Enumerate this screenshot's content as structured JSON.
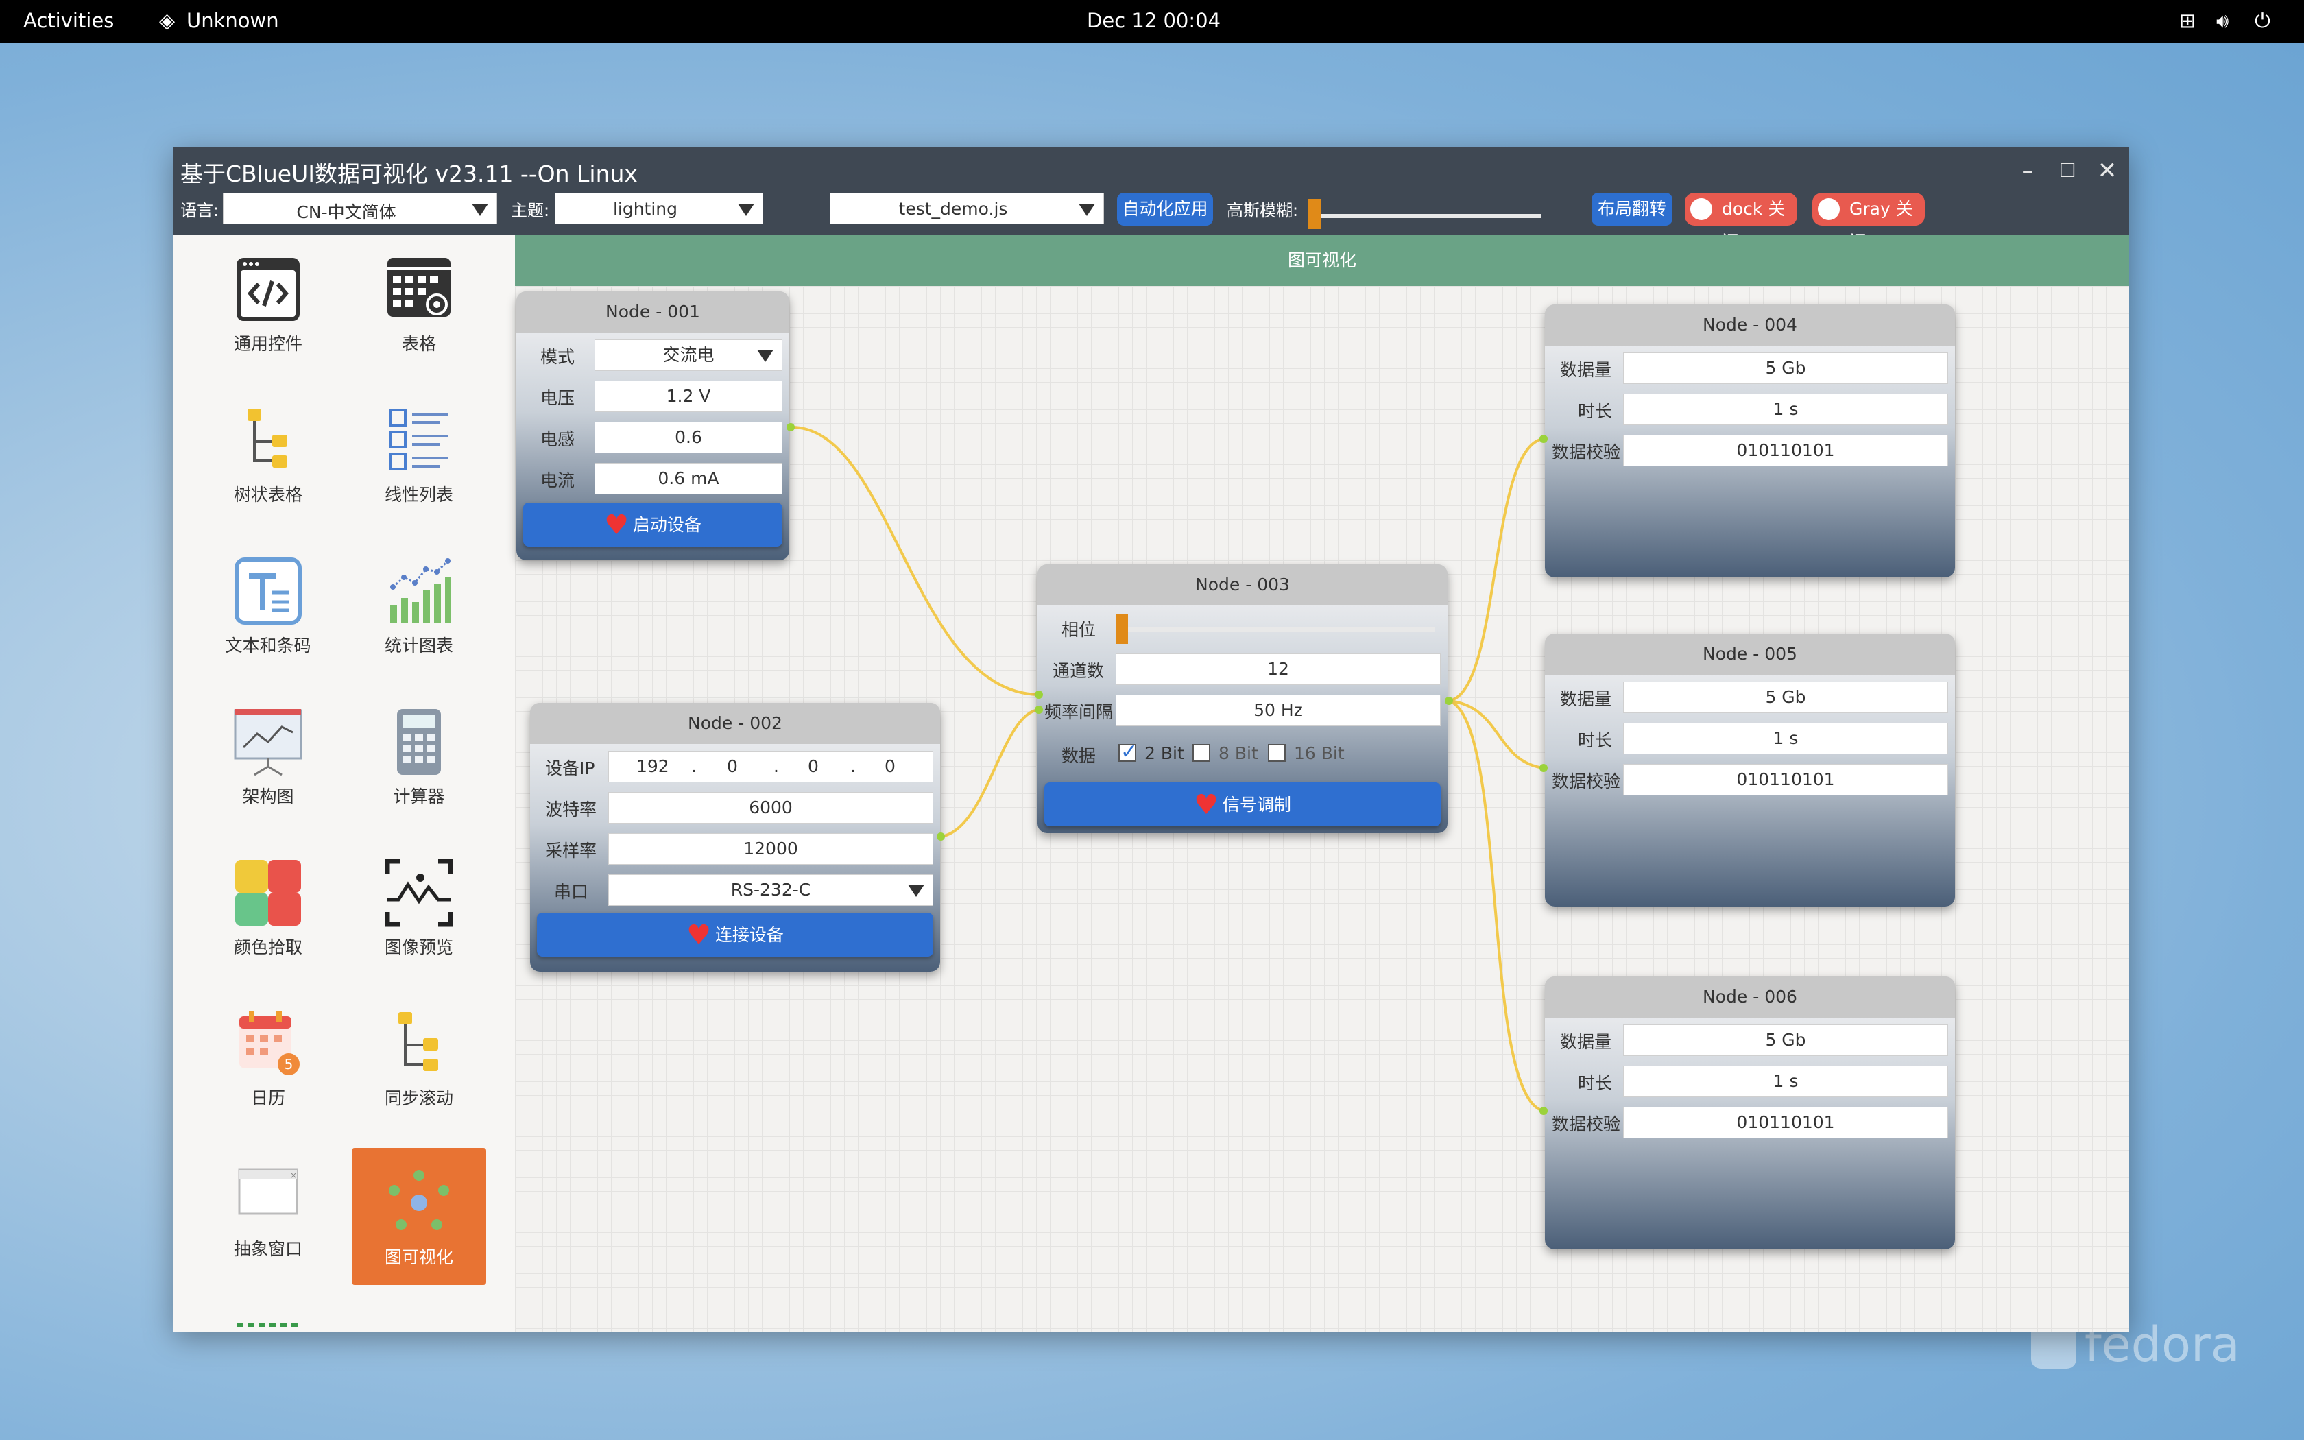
{
  "topbar": {
    "activities": "Activities",
    "app_name": "Unknown",
    "clock": "Dec 12  00:04"
  },
  "window": {
    "title": "基于CBlueUI数据可视化 v23.11 --On Linux",
    "toolbar": {
      "language_label": "语言:",
      "language_value": "CN-中文简体",
      "theme_label": "主题:",
      "theme_value": "lighting",
      "script_value": "test_demo.js",
      "auto_apply_button": "自动化应用",
      "blur_label": "高斯模糊:",
      "blur_value": 0.0,
      "layout_flip_button": "布局翻转",
      "dock_toggle": "dock 关闭",
      "gray_toggle": "Gray 关闭"
    }
  },
  "sidebar": {
    "items": [
      {
        "label": "通用控件",
        "icon": "code-window-icon"
      },
      {
        "label": "表格",
        "icon": "calendar-grid-icon"
      },
      {
        "label": "树状表格",
        "icon": "tree-table-icon"
      },
      {
        "label": "线性列表",
        "icon": "list-icon"
      },
      {
        "label": "文本和条码",
        "icon": "text-icon"
      },
      {
        "label": "统计图表",
        "icon": "stat-chart-icon"
      },
      {
        "label": "架构图",
        "icon": "presentation-icon"
      },
      {
        "label": "计算器",
        "icon": "calculator-icon"
      },
      {
        "label": "颜色拾取",
        "icon": "color-picker-icon"
      },
      {
        "label": "图像预览",
        "icon": "image-preview-icon"
      },
      {
        "label": "日历",
        "icon": "calendar-icon"
      },
      {
        "label": "同步滚动",
        "icon": "sync-scroll-icon"
      },
      {
        "label": "抽象窗口",
        "icon": "abstract-window-icon"
      },
      {
        "label": "图可视化",
        "icon": "graph-icon"
      }
    ],
    "active": "图可视化"
  },
  "canvas": {
    "header": "图可视化"
  },
  "nodes": {
    "n001": {
      "title": "Node - 001",
      "mode_label": "模式",
      "mode_value": "交流电",
      "voltage_label": "电压",
      "voltage_value": "1.2 V",
      "inductance_label": "电感",
      "inductance_value": "0.6",
      "current_label": "电流",
      "current_value": "0.6 mA",
      "button": "启动设备"
    },
    "n002": {
      "title": "Node - 002",
      "ip_label": "设备IP",
      "ip": [
        "192",
        "0",
        "0",
        "0"
      ],
      "baud_label": "波特率",
      "baud_value": "6000",
      "sample_label": "采样率",
      "sample_value": "12000",
      "port_label": "串口",
      "port_value": "RS-232-C",
      "button": "连接设备"
    },
    "n003": {
      "title": "Node - 003",
      "phase_label": "相位",
      "phase_value": 0.0,
      "channels_label": "通道数",
      "channels_value": "12",
      "freq_label": "频率间隔",
      "freq_value": "50 Hz",
      "data_label": "数据",
      "bits": [
        {
          "label": "2 Bit",
          "checked": true
        },
        {
          "label": "8 Bit",
          "checked": false
        },
        {
          "label": "16 Bit",
          "checked": false
        }
      ],
      "button": "信号调制"
    },
    "n004": {
      "title": "Node - 004",
      "amount_label": "数据量",
      "amount_value": "5 Gb",
      "duration_label": "时长",
      "duration_value": "1 s",
      "checksum_label": "数据校验",
      "checksum_value": "010110101"
    },
    "n005": {
      "title": "Node - 005",
      "amount_label": "数据量",
      "amount_value": "5 Gb",
      "duration_label": "时长",
      "duration_value": "1 s",
      "checksum_label": "数据校验",
      "checksum_value": "010110101"
    },
    "n006": {
      "title": "Node - 006",
      "amount_label": "数据量",
      "amount_value": "5 Gb",
      "duration_label": "时长",
      "duration_value": "1 s",
      "checksum_label": "数据校验",
      "checksum_value": "010110101"
    }
  },
  "colors": {
    "accent_blue": "#2d6fd0",
    "active_orange": "#e87333",
    "header_green": "#6aa386",
    "edge_yellow": "#f2c94c",
    "toggle_red": "#e85a4f"
  }
}
